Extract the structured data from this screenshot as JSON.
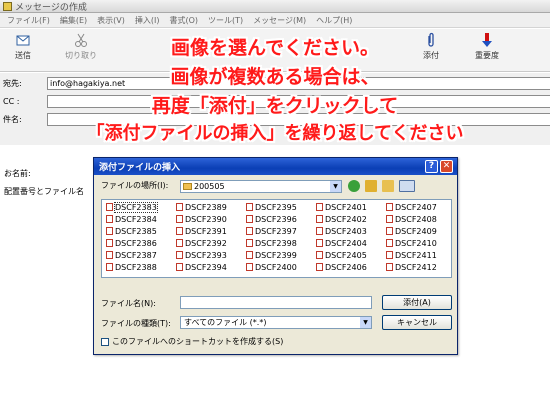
{
  "window": {
    "title": "メッセージの作成"
  },
  "menu": [
    "ファイル(F)",
    "編集(E)",
    "表示(V)",
    "挿入(I)",
    "書式(O)",
    "ツール(T)",
    "メッセージ(M)",
    "ヘルプ(H)"
  ],
  "toolbar": {
    "send": "送信",
    "cut": "切り取り",
    "attach": "添付",
    "priority": "重要度"
  },
  "headers": {
    "to_label": "宛先:",
    "to_value": "info@hagakiya.net",
    "cc_label": "CC :",
    "subject_label": "件名:"
  },
  "body": {
    "name_label": "お名前:",
    "order_label": "配置番号とファイル名"
  },
  "overlay": [
    "画像を選んでください。",
    "画像が複数ある場合は、",
    "再度「添付」をクリックして",
    "「添付ファイルの挿入」を繰り返してください"
  ],
  "dialog": {
    "title": "添付ファイルの挿入",
    "look_in_label": "ファイルの場所(I):",
    "look_in_value": "200505",
    "files": [
      [
        "DSCF2383",
        "DSCF2384",
        "DSCF2385",
        "DSCF2386",
        "DSCF2387",
        "DSCF2388"
      ],
      [
        "DSCF2389",
        "DSCF2390",
        "DSCF2391",
        "DSCF2392",
        "DSCF2393",
        "DSCF2394"
      ],
      [
        "DSCF2395",
        "DSCF2396",
        "DSCF2397",
        "DSCF2398",
        "DSCF2399",
        "DSCF2400"
      ],
      [
        "DSCF2401",
        "DSCF2402",
        "DSCF2403",
        "DSCF2404",
        "DSCF2405",
        "DSCF2406"
      ],
      [
        "DSCF2407",
        "DSCF2408",
        "DSCF2409",
        "DSCF2410",
        "DSCF2411",
        "DSCF2412"
      ]
    ],
    "selected_file": "DSCF2383",
    "filename_label": "ファイル名(N):",
    "filename_value": "",
    "filetype_label": "ファイルの種類(T):",
    "filetype_value": "すべてのファイル (*.*)",
    "attach_button": "添付(A)",
    "cancel_button": "キャンセル",
    "shortcut_checkbox": "このファイルへのショートカットを作成する(S)"
  }
}
